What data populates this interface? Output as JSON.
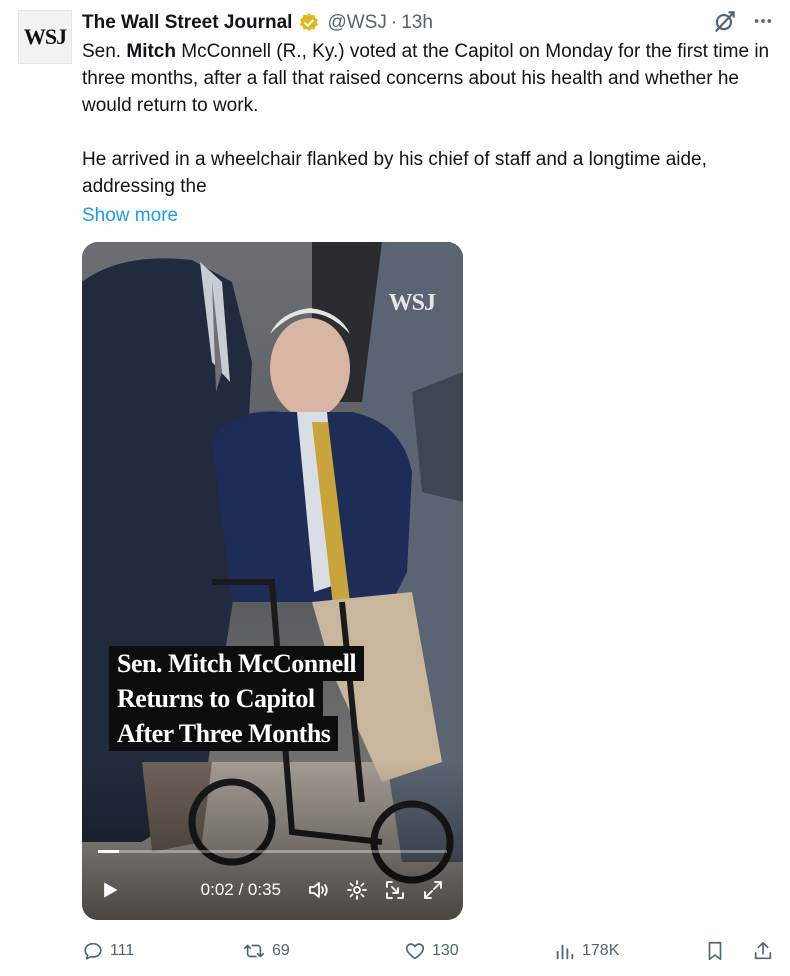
{
  "author": {
    "avatar_text": "WSJ",
    "name": "The Wall Street Journal",
    "verified_badge": "gold-verified-icon",
    "handle": "@WSJ",
    "separator": "·",
    "timestamp": "13h"
  },
  "header_icons": [
    "grok-icon",
    "more-icon"
  ],
  "body": {
    "p1_prefix": "Sen. ",
    "p1_bold": "Mitch",
    "p1_suffix": " McConnell (R., Ky.) voted at the Capitol on Monday for the first time in three months, after a fall that raised concerns about his health and whether he would return to work.",
    "p2": "He arrived in a wheelchair flanked by his chief of staff and a longtime aide, addressing the",
    "show_more": "Show more"
  },
  "video": {
    "watermark": "WSJ",
    "caption_lines": [
      "Sen. Mitch McConnell",
      "Returns to Capitol",
      "After Three Months"
    ],
    "time_display": "0:02 / 0:35",
    "progress_fraction": 0.06,
    "icons": [
      "play-icon",
      "volume-icon",
      "settings-icon",
      "pip-icon",
      "fullscreen-icon"
    ]
  },
  "actions": {
    "replies": "111",
    "reposts": "69",
    "likes": "130",
    "views": "178K"
  },
  "colors": {
    "link": "#1d9bf0",
    "muted": "#536471",
    "text": "#0f1419",
    "verified_gold": "#e2b719"
  }
}
